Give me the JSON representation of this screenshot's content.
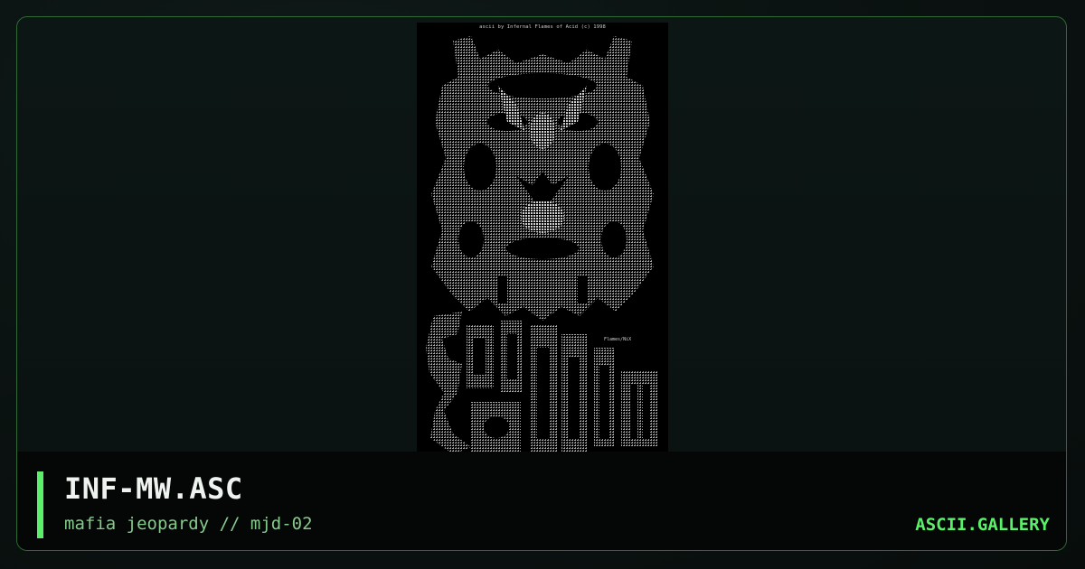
{
  "artwork": {
    "credit_line": "ascii by Infernal Flames of Acid (c) 1998",
    "tag": "Flames/NiX",
    "bg_color": "#000000",
    "glyph_color": "#bfbfbf"
  },
  "card": {
    "title": "INF-MW.ASC",
    "subtitle": "mafia jeopardy // mjd-02",
    "brand": "ASCII.GALLERY",
    "accent_color": "#5bf06a",
    "border_color": "#2f6a34"
  }
}
